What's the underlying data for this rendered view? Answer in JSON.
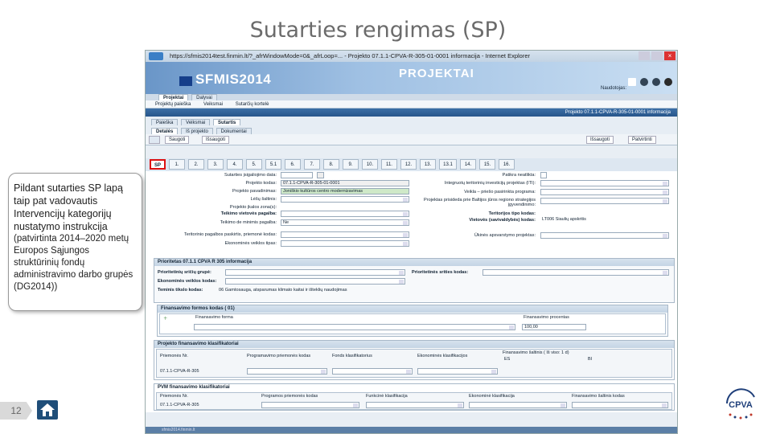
{
  "slide": {
    "title": "Sutarties rengimas (SP)",
    "page_number": "12",
    "note_main": "Pildant sutarties SP lapą taip pat vadovautis Intervencijų kategorijų nustatymo instrukcija",
    "note_sub": "(patvirtinta 2014–2020 metų Europos Sąjungos struktūrinių fondų administravimo darbo grupės (DG2014))",
    "logo_text": "CPVA"
  },
  "browser": {
    "window_title": "https://sfmis2014test.finmin.lt/?_afrWindowMode=0&_afrLoop=... - Projekto 07.1.1-CPVA-R-305-01-0001 informacija - Internet Explorer",
    "brand": "SFMIS2014",
    "module": "PROJEKTAI",
    "user_label": "Naudotojas:",
    "top_tabs": [
      "Projektai",
      "Dalyvai"
    ],
    "menu": [
      "Projektų paieška",
      "Veiksmai",
      "Sutarčių kortelė"
    ],
    "breadcrumb": "Projekto 07.1.1-CPVA-R-305-01-0001 informacija",
    "sub_tabs_row1": [
      "Paieška",
      "Veiksmai",
      "Sutartis"
    ],
    "sub_tabs_row2": [
      "Detalės",
      "Iš projekto",
      "Dokumentai"
    ],
    "toolbar": {
      "left1": "Saugoti",
      "left2": "Išsaugoti",
      "right1": "Išsaugoti",
      "right2": "Patvirtinti"
    },
    "num_tabs": [
      "SP",
      "1.",
      "2.",
      "3.",
      "4.",
      "5.",
      "5.1",
      "6.",
      "7.",
      "8.",
      "9.",
      "10.",
      "11.",
      "12.",
      "13.",
      "13.1",
      "14.",
      "15.",
      "16."
    ],
    "form_left": [
      {
        "label": "Sutarties įsigaliojimo data:",
        "value": ""
      },
      {
        "label": "Projekto kodas:",
        "value": "07.1.1-CPVA-R-305-01-0001"
      },
      {
        "label": "Projekto pavadinimas:",
        "value": "Joniškio kultūros centro modernizavimas"
      },
      {
        "label": "Lėšų šaltinis:",
        "value": ""
      },
      {
        "label": "Projekto įkalos zona(s):",
        "value": ""
      },
      {
        "label": "Teikimo vietovės pagalba:",
        "value": ""
      },
      {
        "label": "Teikimo de minimis pagalba:",
        "value": "Ne"
      },
      {
        "label": "Teritorinio pagalbos paskirtis, priemonė kodas:",
        "value": ""
      },
      {
        "label": "Ekonominės veiklos tipas:",
        "value": ""
      }
    ],
    "form_right": [
      {
        "label": "Patikra neatlikta:",
        "value": ""
      },
      {
        "label": "Integruotų teritorinių investicijų projektas (ITI):",
        "value": ""
      },
      {
        "label": "Veikla – priešo pasirinkta programa:",
        "value": ""
      },
      {
        "label": "Projektas prisideda prie Baltijos jūros regiono strategijos įgyvendinimo:",
        "value": ""
      },
      {
        "label": "Teritorijos tipo kodas:",
        "value": ""
      },
      {
        "label": "Vietovės (savivaldybės) kodas:",
        "value": "LT006 Šiaulių apskritis"
      },
      {
        "label": "Ūkinės apsvarstymo projektas:",
        "value": ""
      }
    ],
    "priority_panel": {
      "title": "Prioritetas 07.1.1 CPVA R 305 informacija",
      "field1": "Prioritetinių sričių grupė:",
      "field2": "Prioritetinės srities kodas:",
      "field3": "Ekonominės veiklos kodas:",
      "field4_label": "Teminis tikslo kodas:",
      "field4_value": "06 Gamtosauga, atsparumas klimato kaitai ir išteklių naudojimas"
    },
    "finance_panel": {
      "title": "Finansavimo formos kodas ( 01)",
      "col1": "Finansavimo forma",
      "col2": "Finansavimo procentas",
      "pct_value": "100,00"
    },
    "classifier_panel": {
      "title": "Projekto finansavimo klasifikatoriai",
      "cols": [
        "Priemonės Nr.",
        "Programavimo priemonės kodas",
        "Fonds klasifikatorius",
        "Ekonominės klasifikacijos",
        "Finansavimo šaltinis ( Iš viso: 1 d)"
      ],
      "row": [
        "07.1.1-CPVA-R-305",
        "",
        "",
        "",
        ""
      ],
      "sub_cols": [
        "ES",
        "BI"
      ]
    },
    "pvm_panel": {
      "title": "PVM finansavimo klasifikatoriai",
      "cols": [
        "Priemonės Nr.",
        "Programos priemonės kodas",
        "Funkcinė klasifikacija",
        "Ekonominė klasifikacija",
        "Finansavimo šaltinis kodas"
      ],
      "row": [
        "07.1.1-CPVA-R-305"
      ]
    },
    "footer": "sfmis2014.finmin.lt"
  }
}
